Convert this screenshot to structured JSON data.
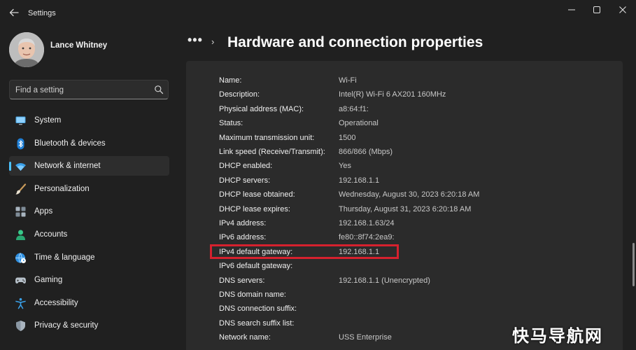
{
  "app": {
    "title": "Settings",
    "back_icon": "back-arrow-icon"
  },
  "window_controls": {
    "minimize": "—",
    "maximize": "☐",
    "close": "✕"
  },
  "user": {
    "name": "Lance Whitney"
  },
  "search": {
    "placeholder": "Find a setting",
    "icon": "search-icon"
  },
  "sidebar": {
    "items": [
      {
        "label": "System",
        "icon": "monitor-icon",
        "active": false
      },
      {
        "label": "Bluetooth & devices",
        "icon": "bluetooth-icon",
        "active": false
      },
      {
        "label": "Network & internet",
        "icon": "wifi-icon",
        "active": true
      },
      {
        "label": "Personalization",
        "icon": "brush-icon",
        "active": false
      },
      {
        "label": "Apps",
        "icon": "apps-icon",
        "active": false
      },
      {
        "label": "Accounts",
        "icon": "person-icon",
        "active": false
      },
      {
        "label": "Time & language",
        "icon": "globe-clock-icon",
        "active": false
      },
      {
        "label": "Gaming",
        "icon": "gamepad-icon",
        "active": false
      },
      {
        "label": "Accessibility",
        "icon": "accessibility-icon",
        "active": false
      },
      {
        "label": "Privacy & security",
        "icon": "shield-icon",
        "active": false
      }
    ]
  },
  "breadcrumb": {
    "overflow": "•••",
    "separator": "›",
    "title": "Hardware and connection properties"
  },
  "properties": [
    {
      "key": "Name:",
      "value": "Wi-Fi"
    },
    {
      "key": "Description:",
      "value": "Intel(R) Wi-Fi 6 AX201 160MHz"
    },
    {
      "key": "Physical address (MAC):",
      "value": "a8:64:f1:"
    },
    {
      "key": "Status:",
      "value": "Operational"
    },
    {
      "key": "Maximum transmission unit:",
      "value": "1500"
    },
    {
      "key": "Link speed (Receive/Transmit):",
      "value": "866/866 (Mbps)"
    },
    {
      "key": "DHCP enabled:",
      "value": "Yes"
    },
    {
      "key": "DHCP servers:",
      "value": "192.168.1.1"
    },
    {
      "key": "DHCP lease obtained:",
      "value": "Wednesday, August 30, 2023 6:20:18 AM"
    },
    {
      "key": "DHCP lease expires:",
      "value": "Thursday, August 31, 2023 6:20:18 AM"
    },
    {
      "key": "IPv4 address:",
      "value": "192.168.1.63/24"
    },
    {
      "key": "IPv6 address:",
      "value": "fe80::8f74:2ea9:"
    },
    {
      "key": "IPv4 default gateway:",
      "value": "192.168.1.1"
    },
    {
      "key": "IPv6 default gateway:",
      "value": ""
    },
    {
      "key": "DNS servers:",
      "value": "192.168.1.1 (Unencrypted)"
    },
    {
      "key": "DNS domain name:",
      "value": ""
    },
    {
      "key": "DNS connection suffix:",
      "value": ""
    },
    {
      "key": "DNS search suffix list:",
      "value": ""
    },
    {
      "key": "Network name:",
      "value": "USS Enterprise"
    }
  ],
  "highlighted_property": "IPv4 default gateway:",
  "colors": {
    "accent": "#4cc2ff",
    "highlight_border": "#d6212e",
    "background": "#202020",
    "panel": "#2b2b2b"
  },
  "watermark": "快马导航网"
}
